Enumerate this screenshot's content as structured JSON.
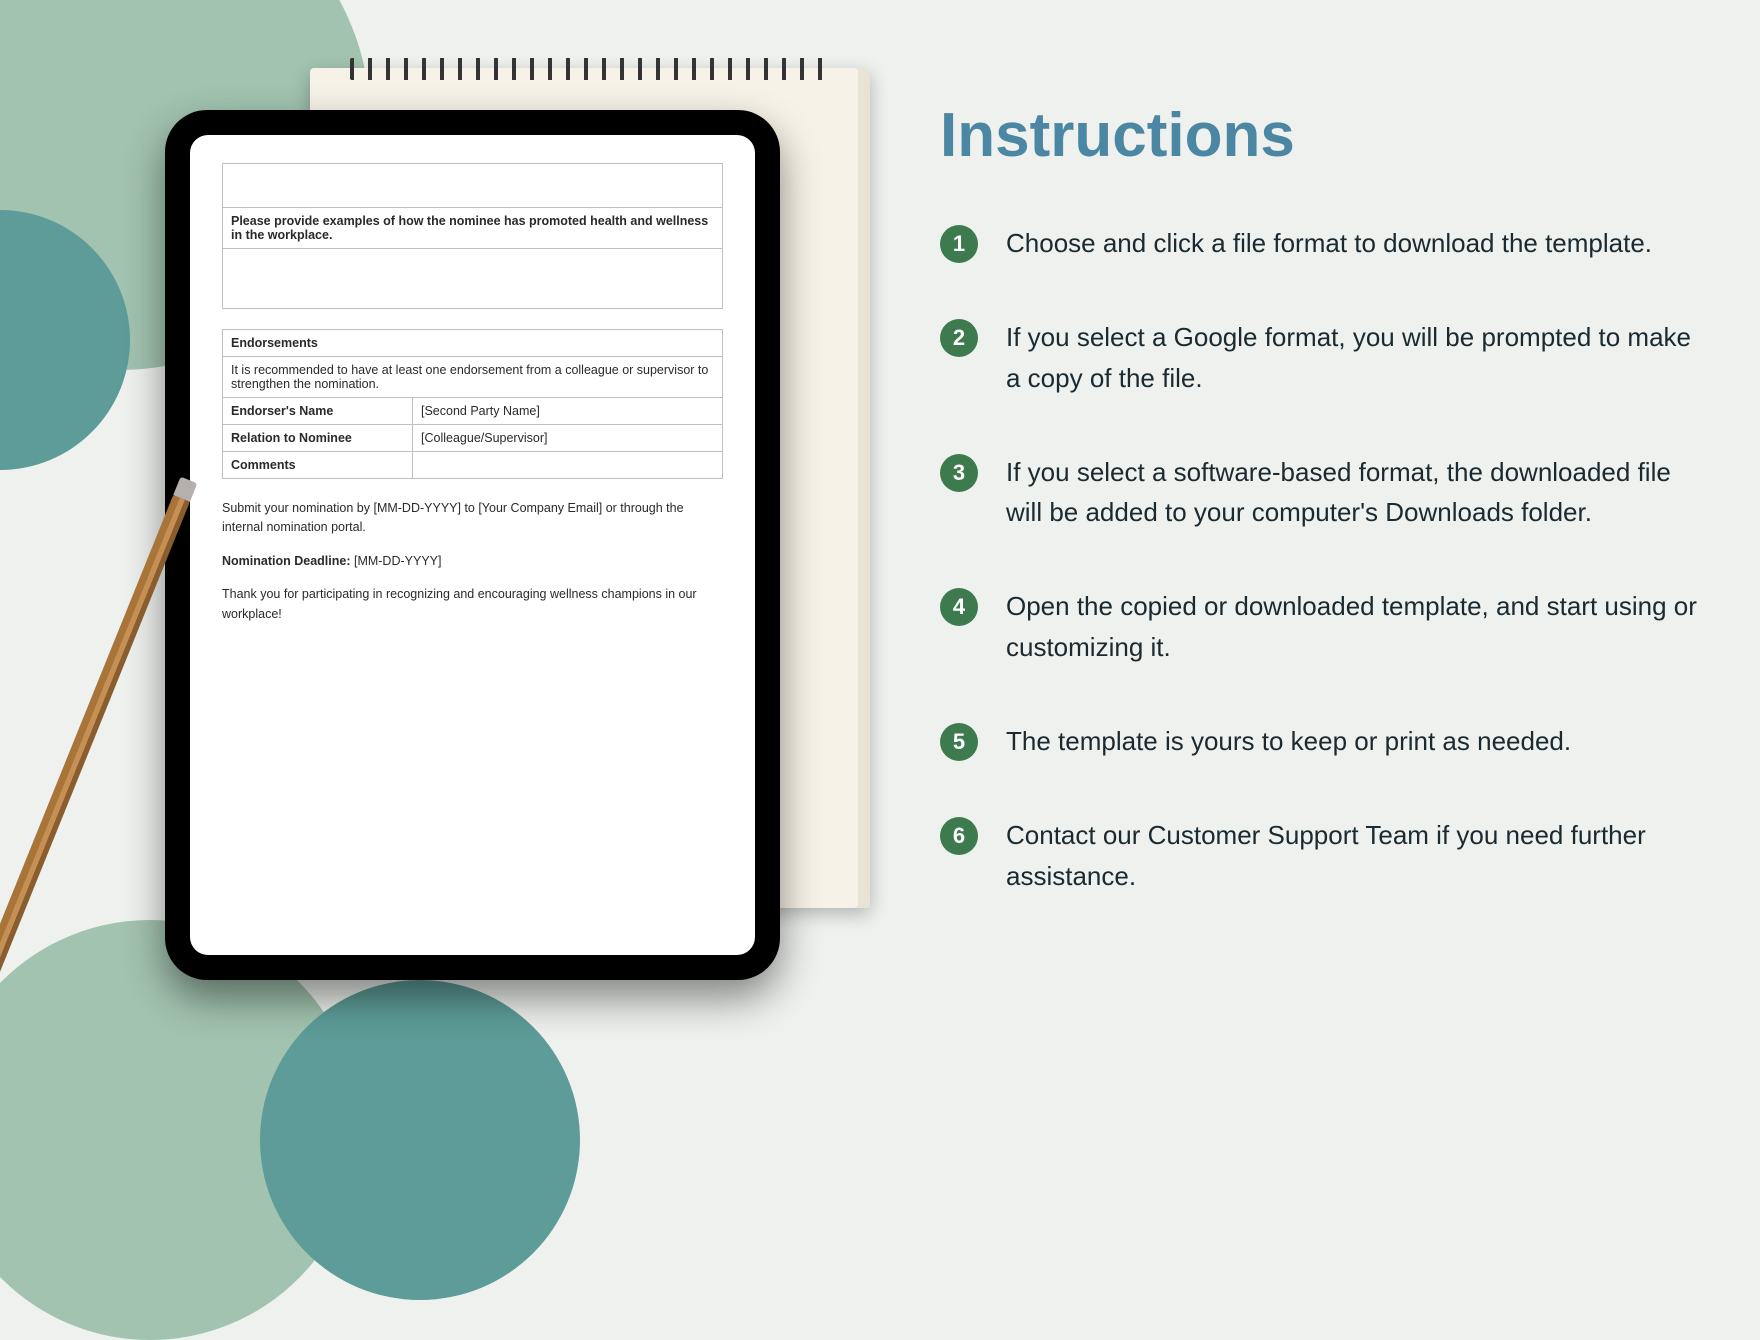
{
  "instructions": {
    "heading": "Instructions",
    "steps": [
      "Choose and click a file format to download the template.",
      "If you select a Google format, you will be prompted to make a copy of the file.",
      "If you select a software-based format, the downloaded file will be added to your computer's Downloads folder.",
      "Open the copied or downloaded template, and start using or customizing it.",
      "The template is yours to keep or print as needed.",
      "Contact our Customer Support Team if you need further assistance."
    ]
  },
  "document": {
    "prompt1": "Please provide examples of how the nominee has promoted health and wellness in the workplace.",
    "endorsements_header": "Endorsements",
    "endorsements_note": "It is recommended to have at least one endorsement from a colleague or supervisor to strengthen the nomination.",
    "rows": {
      "endorser_name": {
        "label": "Endorser's Name",
        "value": "[Second Party Name]"
      },
      "relation": {
        "label": "Relation to Nominee",
        "value": "[Colleague/Supervisor]"
      },
      "comments": {
        "label": "Comments",
        "value": ""
      }
    },
    "submit_text": "Submit your nomination by [MM-DD-YYYY] to [Your Company Email] or through the internal nomination portal.",
    "deadline_label": "Nomination Deadline:",
    "deadline_value": "[MM-DD-YYYY]",
    "thankyou": "Thank you for participating in recognizing and encouraging wellness champions in our workplace!"
  }
}
